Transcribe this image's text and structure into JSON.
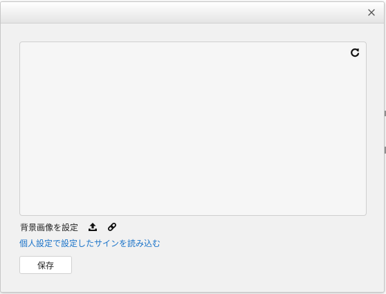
{
  "dialog": {
    "close_icon": "close-icon",
    "canvas": {
      "refresh_icon": "refresh-icon"
    },
    "background": {
      "label": "背景画像を設定",
      "upload_icon": "upload-icon",
      "link_icon": "link-icon"
    },
    "load_sign_link": "個人設定で設定したサインを読み込む",
    "save_label": "保存"
  },
  "colors": {
    "dialog_bg": "#f1f1f1",
    "canvas_bg": "#f6f6f6",
    "link": "#1a73c9",
    "border": "#cfcfcf"
  }
}
